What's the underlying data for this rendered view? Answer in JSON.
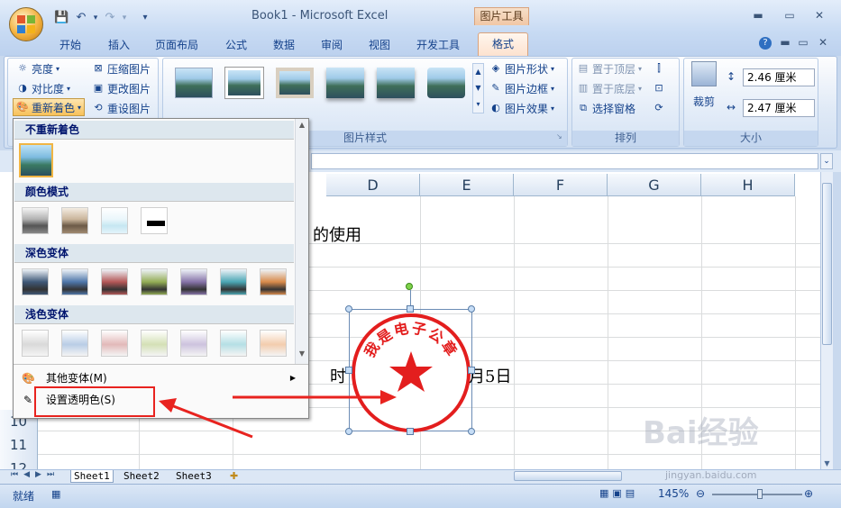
{
  "window": {
    "title": "Book1 - Microsoft Excel",
    "contextual_group": "图片工具",
    "minimize": "▬",
    "maximize": "▭",
    "close": "✕"
  },
  "qat": {
    "save_icon": "save-icon",
    "undo_icon": "undo-icon",
    "redo_icon": "redo-icon",
    "customize_icon": "customize-icon"
  },
  "tabs": [
    {
      "label": "开始"
    },
    {
      "label": "插入"
    },
    {
      "label": "页面布局"
    },
    {
      "label": "公式"
    },
    {
      "label": "数据"
    },
    {
      "label": "审阅"
    },
    {
      "label": "视图"
    },
    {
      "label": "开发工具"
    },
    {
      "label": "格式"
    }
  ],
  "ribbon": {
    "adjust": {
      "brightness": "亮度",
      "contrast": "对比度",
      "recolor": "重新着色",
      "compress": "压缩图片",
      "change": "更改图片",
      "reset": "重设图片"
    },
    "picture_styles": {
      "label": "图片样式",
      "shape": "图片形状",
      "border": "图片边框",
      "effects": "图片效果"
    },
    "arrange": {
      "label": "排列",
      "bring_front": "置于顶层",
      "send_back": "置于底层",
      "selection_pane": "选择窗格"
    },
    "size": {
      "label": "大小",
      "crop": "裁剪",
      "height": "2.46 厘米",
      "width": "2.47 厘米"
    }
  },
  "recolor_menu": {
    "no_recolor": "不重新着色",
    "color_modes": "颜色模式",
    "dark_variations": "深色变体",
    "light_variations": "浅色变体",
    "more_variations": "其他变体(M)",
    "set_transparent": "设置透明色(S)",
    "dark_colors": [
      "#3f5877",
      "#4e76a9",
      "#b45757",
      "#93ad55",
      "#8673a8",
      "#4aa6b4",
      "#d88a4a"
    ],
    "light_colors": [
      "#d9d9d9",
      "#b9cde6",
      "#e2b9b9",
      "#d4e0b6",
      "#cdc3de",
      "#b5dfe5",
      "#f3cdae"
    ]
  },
  "sheet": {
    "columns": [
      "D",
      "E",
      "F",
      "G",
      "H"
    ],
    "rows": [
      "10",
      "11",
      "12"
    ],
    "cell_text_1": "的使用",
    "cell_text_2": "时",
    "cell_text_3": "月5日",
    "stamp_text": "我是电子公章"
  },
  "sheet_tabs": [
    "Sheet1",
    "Sheet2",
    "Sheet3"
  ],
  "status": {
    "ready": "就绪",
    "zoom": "145%"
  },
  "watermark": {
    "text": "Bai经验",
    "url": "jingyan.baidu.com"
  },
  "colors": {
    "accent_red": "#e8231f",
    "stamp_red": "#e31e1e",
    "contextual": "#f1c7a5"
  }
}
